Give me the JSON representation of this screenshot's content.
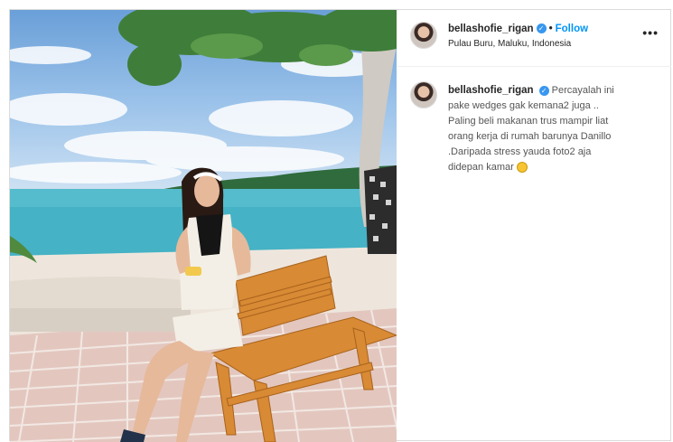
{
  "post": {
    "image": {
      "description_icon": "beach-photo",
      "colors": {
        "sky": "#7fb0e3",
        "sea": "#4fb7c9",
        "sand": "#efe7dc",
        "bench": "#d9892e"
      }
    },
    "header": {
      "username": "bellashofie_rigan",
      "separator": "•",
      "follow_label": "Follow",
      "location": "Pulau Buru, Maluku, Indonesia",
      "more_icon": "ellipsis-icon",
      "more_label": "•••"
    },
    "caption": {
      "username": "bellashofie_rigan",
      "lines": [
        "Percayalah ini",
        "pake wedges gak kemana2 juga ..",
        "Paling beli makanan trus mampir liat",
        "orang kerja di rumah barunya Danillo",
        ".Daripada stress yauda foto2 aja",
        "didepan kamar"
      ],
      "emoji": "grinning-face-emoji"
    }
  }
}
